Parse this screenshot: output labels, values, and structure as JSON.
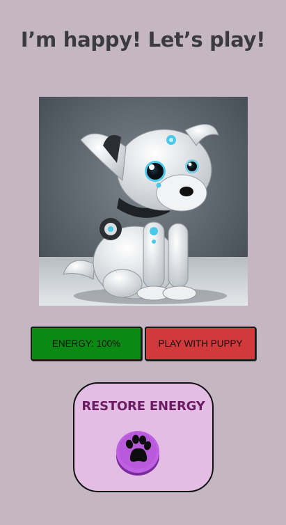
{
  "header": {
    "title": "I’m happy! Let’s play!"
  },
  "puppy_image": {
    "icon": "robot-puppy-image"
  },
  "controls": {
    "energy_label": "ENERGY: 100%",
    "energy_value": 100,
    "play_label": "PLAY WITH PUPPY"
  },
  "restore": {
    "label": "RESTORE ENERGY",
    "icon": "paw-icon"
  },
  "colors": {
    "background": "#c4b6c2",
    "energy_button": "#0a8a12",
    "play_button": "#d2393a",
    "restore_card": "#e3bde3",
    "restore_text": "#6b1c62",
    "paw_button": "#b35ad8"
  }
}
